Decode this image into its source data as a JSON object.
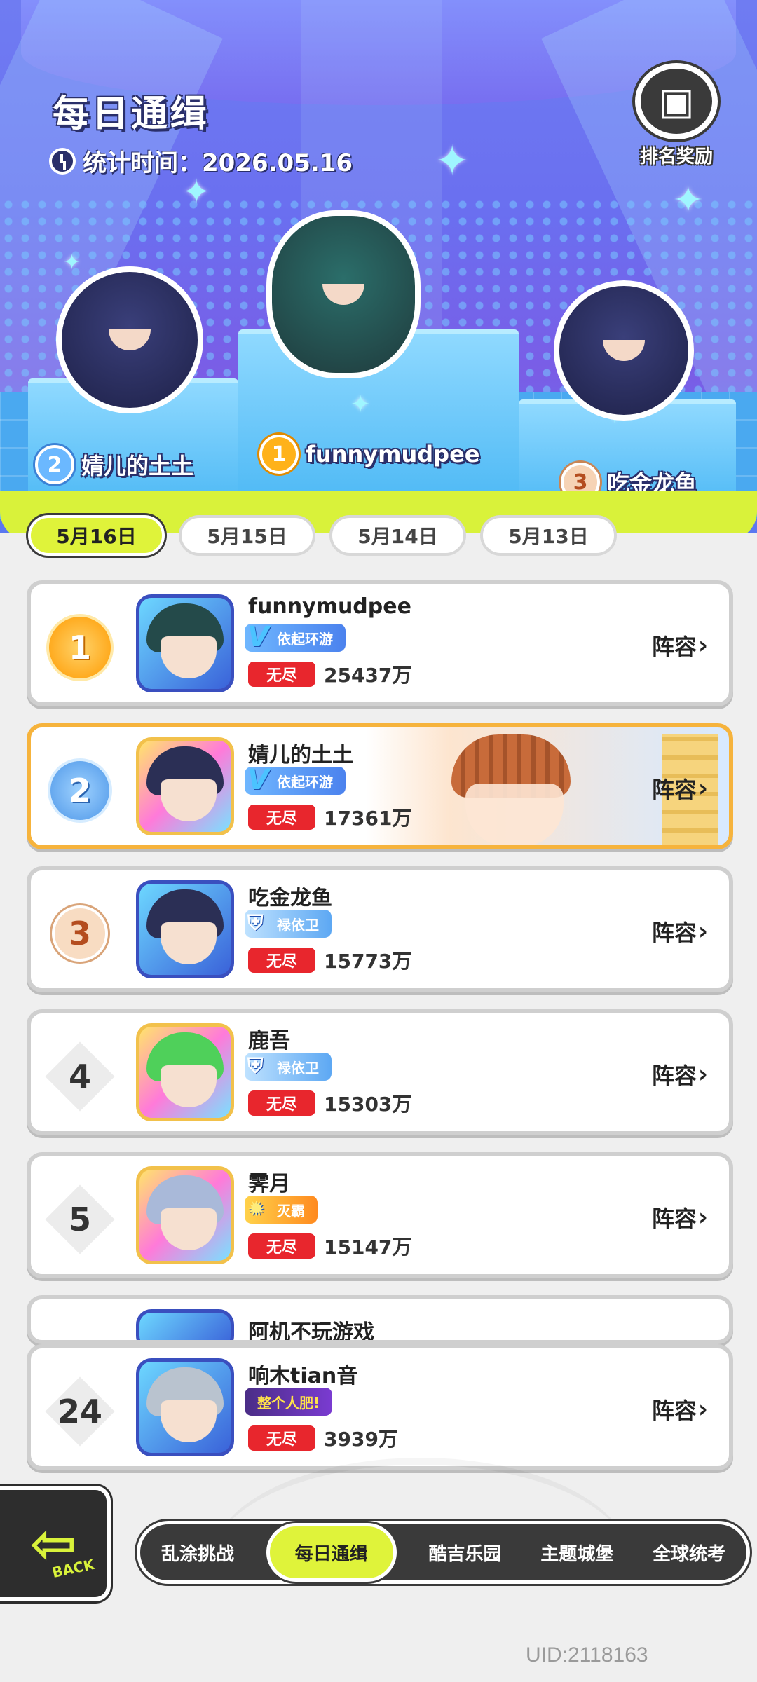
{
  "header": {
    "title": "每日通缉",
    "stat_time": "统计时间：2026.05.16",
    "reward_label": "排名奖励"
  },
  "podium": [
    {
      "rank": "1",
      "name": "funnymudpee"
    },
    {
      "rank": "2",
      "name": "婧儿的土土"
    },
    {
      "rank": "3",
      "name": "吃金龙鱼"
    }
  ],
  "date_tabs": [
    "5月16日",
    "5月15日",
    "5月14日",
    "5月13日"
  ],
  "list": [
    {
      "rank": "1",
      "name": "funnymudpee",
      "badge": "依起环游",
      "mode": "无尽",
      "score": "25437万",
      "lineup": "阵容"
    },
    {
      "rank": "2",
      "name": "婧儿的土土",
      "badge": "依起环游",
      "mode": "无尽",
      "score": "17361万",
      "lineup": "阵容"
    },
    {
      "rank": "3",
      "name": "吃金龙鱼",
      "badge": "禄依卫",
      "mode": "无尽",
      "score": "15773万",
      "lineup": "阵容"
    },
    {
      "rank": "4",
      "name": "鹿吾",
      "badge": "禄依卫",
      "mode": "无尽",
      "score": "15303万",
      "lineup": "阵容"
    },
    {
      "rank": "5",
      "name": "霁月",
      "badge": "灭霸",
      "mode": "无尽",
      "score": "15147万",
      "lineup": "阵容"
    },
    {
      "name": "阿机不玩游戏"
    }
  ],
  "self_row": {
    "rank": "24",
    "name": "响木tian音",
    "badge": "整个人肥!",
    "mode": "无尽",
    "score": "3939万",
    "lineup": "阵容"
  },
  "nav": {
    "back_label": "BACK",
    "items": [
      "乱涂挑战",
      "每日通缉",
      "酷吉乐园",
      "主题城堡",
      "全球统考"
    ]
  },
  "uid": "UID:2118163",
  "colors": {
    "accent_lime": "#dff33a",
    "mode_red": "#e8262d",
    "highlight_orange": "#f6b33c"
  }
}
